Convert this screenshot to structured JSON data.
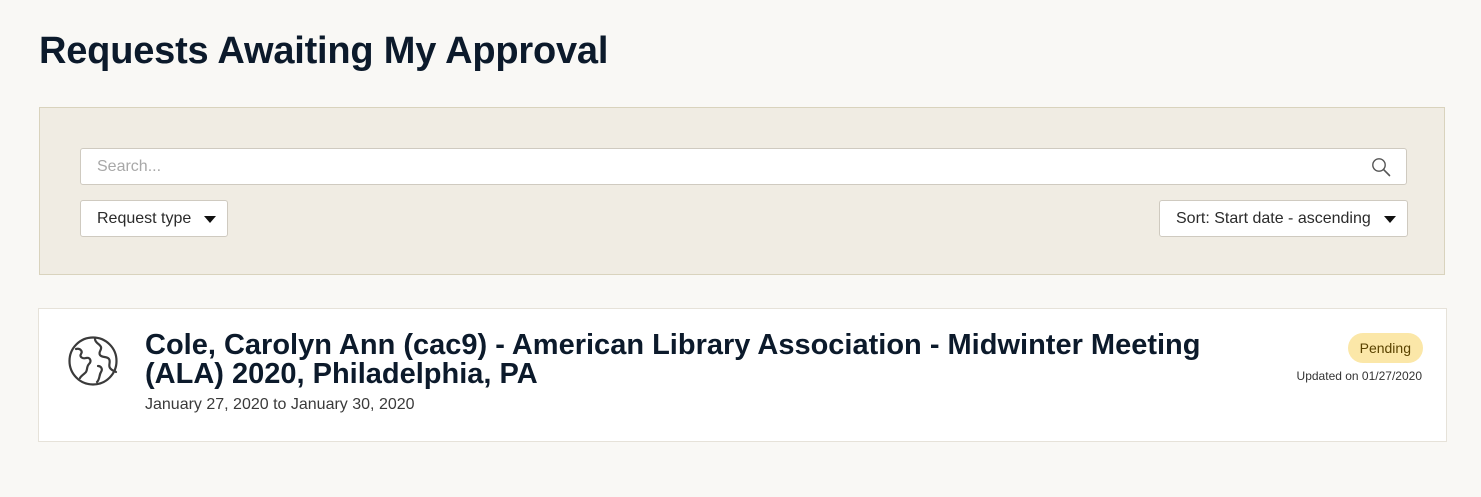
{
  "header": {
    "title": "Requests Awaiting My Approval"
  },
  "filters": {
    "search": {
      "placeholder": "Search...",
      "value": ""
    },
    "request_type": {
      "label": "Request type"
    },
    "sort": {
      "label": "Sort: Start date - ascending"
    }
  },
  "requests": [
    {
      "icon": "globe-icon",
      "title": "Cole, Carolyn Ann (cac9) - American Library Association - Midwinter Meeting (ALA) 2020, Philadelphia, PA",
      "dates": "January 27, 2020 to January 30, 2020",
      "status": "Pending",
      "updated": "Updated on 01/27/2020"
    }
  ],
  "colors": {
    "background": "#f9f8f5",
    "filter_panel": "#f0ece3",
    "heading": "#0c1a2b",
    "pending_badge": "#fbe7a8"
  }
}
